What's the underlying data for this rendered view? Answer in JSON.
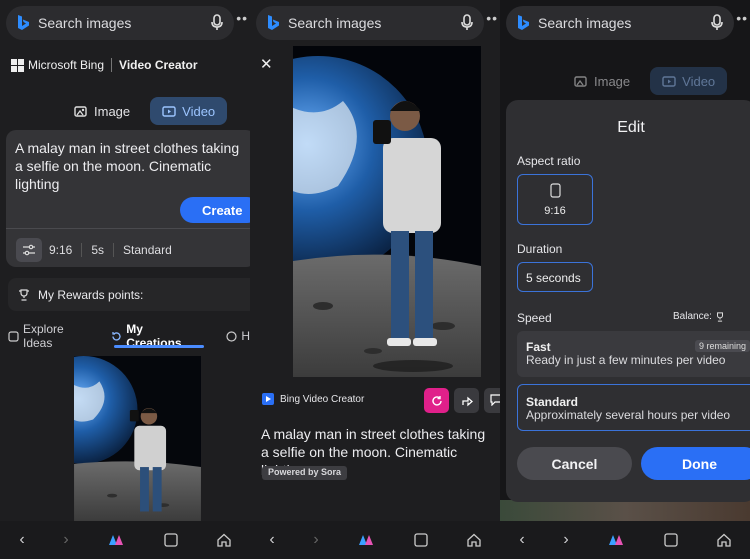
{
  "colors": {
    "accent": "#2a6ff5",
    "magenta": "#e0208a",
    "selected_border": "#3b73d9"
  },
  "search": {
    "label": "Search images"
  },
  "panel1": {
    "brand": "Microsoft Bing",
    "product": "Video Creator",
    "tabs": [
      {
        "label": "Image"
      },
      {
        "label": "Video"
      }
    ],
    "prompt": "A malay man in street clothes taking a selfie on the moon. Cinematic lighting",
    "create_label": "Create",
    "settings": {
      "aspect": "9:16",
      "duration": "5s",
      "speed": "Standard"
    },
    "rewards": "My Rewards points:",
    "subtabs": [
      {
        "label": "Explore Ideas"
      },
      {
        "label": "My Creations"
      },
      {
        "label": "H"
      }
    ]
  },
  "panel2": {
    "creator_label": "Bing Video Creator",
    "caption": "A malay man in street clothes taking a selfie on the moon. Cinematic lighting",
    "powered": "Powered by Sora"
  },
  "panel3": {
    "tabs": [
      {
        "label": "Image"
      },
      {
        "label": "Video"
      }
    ],
    "title": "Edit",
    "aspect_label": "Aspect ratio",
    "aspect_value": "9:16",
    "duration_label": "Duration",
    "duration_value": "5 seconds",
    "speed_label": "Speed",
    "balance_label": "Balance:",
    "fast_title": "Fast",
    "fast_desc": "Ready in just a few minutes per video",
    "fast_badge": "9 remaining",
    "std_title": "Standard",
    "std_desc": "Approximately several hours per video",
    "cancel": "Cancel",
    "done": "Done"
  }
}
